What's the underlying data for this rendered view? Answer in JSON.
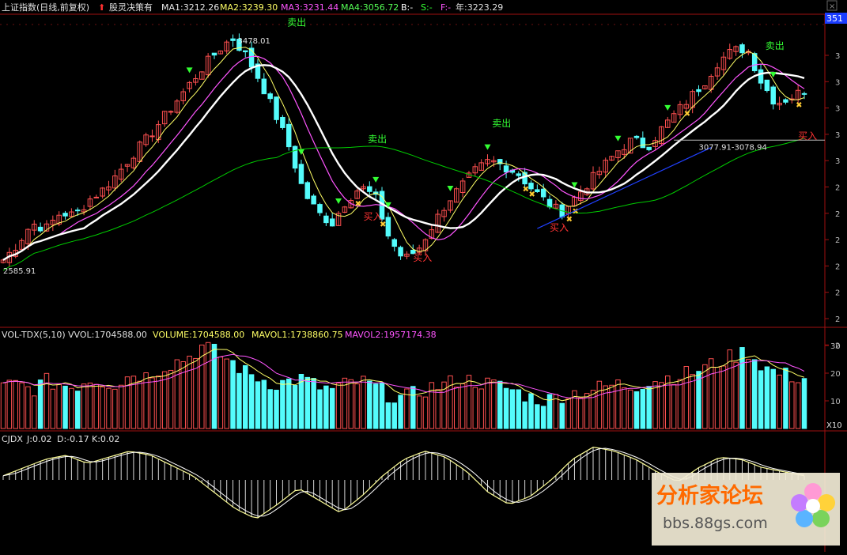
{
  "header": {
    "index_name": "上证指数(日线,前复权)",
    "strategy": "股灵决策有",
    "ma1": "MA1:3212.26",
    "ma2": "MA2:3239.30",
    "ma3": "MA3:3231.44",
    "ma4": "MA4:3056.72",
    "b": "B:-",
    "s": "S:-",
    "f": "F:-",
    "year": "年:3223.29",
    "right_tag": "351"
  },
  "colors": {
    "background": "#000000",
    "bull": "#ff5050",
    "bear": "#54fcfc",
    "ma1": "#ffff66",
    "ma2": "#ff55ff",
    "ma3": "#ffffff",
    "ma4": "#00cc00",
    "frame": "#a01010",
    "sell": "#33ff33",
    "buy": "#ff3333"
  },
  "price_panel": {
    "high_label": "3478.01",
    "low_label": "2585.91",
    "level_label": "3077.91-3078.94",
    "sell_label": "卖出",
    "buy_label": "买入",
    "y_ticks": [
      "3",
      "3",
      "3",
      "3",
      "3",
      "2",
      "2",
      "2",
      "2",
      "2",
      "2",
      "2"
    ]
  },
  "volume_panel": {
    "title": "VOL-TDX(5,10)",
    "vvol": "VVOL:1704588.00",
    "volume": "VOLUME:1704588.00",
    "mavol1": "MAVOL1:1738860.75",
    "mavol2": "MAVOL2:1957174.38",
    "y_ticks": [
      "30",
      "20",
      "10"
    ],
    "unit": "X10"
  },
  "indicator_panel": {
    "name": "CJDX",
    "j": "J:0.02",
    "d": "D:-0.17",
    "k": "K:0.02"
  },
  "watermark": {
    "title": "分析家论坛",
    "url": "bbs.88gs.com"
  },
  "chart_data": {
    "type": "candlestick",
    "price_range": [
      2585.91,
      3478.01
    ],
    "annotations": {
      "high": 3478.01,
      "low": 2585.91,
      "level_low": 3077.91,
      "level_high": 3078.94
    },
    "price_anchors_close": [
      2620,
      2680,
      2760,
      2740,
      2800,
      2790,
      2850,
      2890,
      2950,
      3020,
      3080,
      3150,
      3220,
      3290,
      3360,
      3420,
      3470,
      3400,
      3300,
      3180,
      3050,
      2880,
      2800,
      2760,
      2850,
      2900,
      2860,
      2700,
      2620,
      2660,
      2750,
      2840,
      2900,
      2960,
      3000,
      2980,
      2950,
      2890,
      2840,
      2800,
      2860,
      2920,
      2980,
      3040,
      3080,
      3050,
      3120,
      3180,
      3240,
      3300,
      3380,
      3420,
      3430,
      3300,
      3220,
      3240,
      3270
    ],
    "volume_anchors": [
      15,
      16,
      14,
      17,
      16,
      15,
      18,
      17,
      16,
      20,
      19,
      22,
      24,
      26,
      30,
      27,
      24,
      20,
      18,
      16,
      17,
      18,
      15,
      14,
      16,
      17,
      15,
      12,
      11,
      13,
      15,
      16,
      18,
      17,
      16,
      15,
      13,
      11,
      10,
      12,
      13,
      14,
      15,
      16,
      15,
      17,
      18,
      19,
      20,
      22,
      24,
      26,
      28,
      23,
      20,
      19,
      18
    ],
    "indicator_anchors": [
      0.1,
      0.3,
      0.5,
      0.6,
      0.4,
      0.55,
      0.7,
      0.6,
      0.35,
      0.1,
      -0.3,
      -0.7,
      -0.95,
      -0.6,
      -0.2,
      -0.5,
      -0.8,
      -0.4,
      0.1,
      0.5,
      0.7,
      0.55,
      0.2,
      -0.3,
      -0.6,
      -0.4,
      0.0,
      0.5,
      0.8,
      0.7,
      0.5,
      0.2,
      -0.05,
      0.3,
      0.55,
      0.5,
      0.3,
      0.2,
      0.1
    ]
  }
}
